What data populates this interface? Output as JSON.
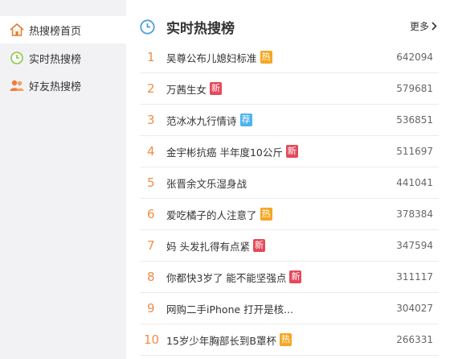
{
  "sidebar": {
    "items": [
      {
        "label": "热搜榜首页",
        "icon": "home-icon",
        "active": true
      },
      {
        "label": "实时热搜榜",
        "icon": "clock-icon",
        "active": false
      },
      {
        "label": "好友热搜榜",
        "icon": "friends-icon",
        "active": false
      }
    ]
  },
  "header": {
    "title": "实时热搜榜",
    "more_label": "更多"
  },
  "list": [
    {
      "rank": "1",
      "keyword": "吴尊公布儿媳妇标准",
      "badge": "热",
      "badge_type": "hot",
      "count": "642094"
    },
    {
      "rank": "2",
      "keyword": "万茜生女",
      "badge": "新",
      "badge_type": "new",
      "count": "579681"
    },
    {
      "rank": "3",
      "keyword": "范冰冰九行情诗",
      "badge": "荐",
      "badge_type": "rec",
      "count": "536851"
    },
    {
      "rank": "4",
      "keyword": "金宇彬抗癌 半年度10公斤",
      "badge": "新",
      "badge_type": "new",
      "count": "511697"
    },
    {
      "rank": "5",
      "keyword": "张晋余文乐湿身战",
      "badge": "",
      "badge_type": "",
      "count": "441041"
    },
    {
      "rank": "6",
      "keyword": "爱吃橘子的人注意了",
      "badge": "热",
      "badge_type": "hot",
      "count": "378384"
    },
    {
      "rank": "7",
      "keyword": "妈 头发扎得有点紧",
      "badge": "新",
      "badge_type": "new",
      "count": "347594"
    },
    {
      "rank": "8",
      "keyword": "你都快3岁了 能不能坚强点",
      "badge": "新",
      "badge_type": "new",
      "count": "311117"
    },
    {
      "rank": "9",
      "keyword": "网购二手iPhone 打开是核...",
      "badge": "",
      "badge_type": "",
      "count": "304027"
    },
    {
      "rank": "10",
      "keyword": "15岁少年胸部长到B罩杯",
      "badge": "热",
      "badge_type": "hot",
      "count": "266331"
    }
  ],
  "colors": {
    "rank": "#f28c48",
    "hot_badge": "#f5a623",
    "new_badge": "#e4495a",
    "rec_badge": "#4db2ef",
    "sidebar_bg": "#f2f2f5",
    "clock": "#4a9fd8"
  }
}
